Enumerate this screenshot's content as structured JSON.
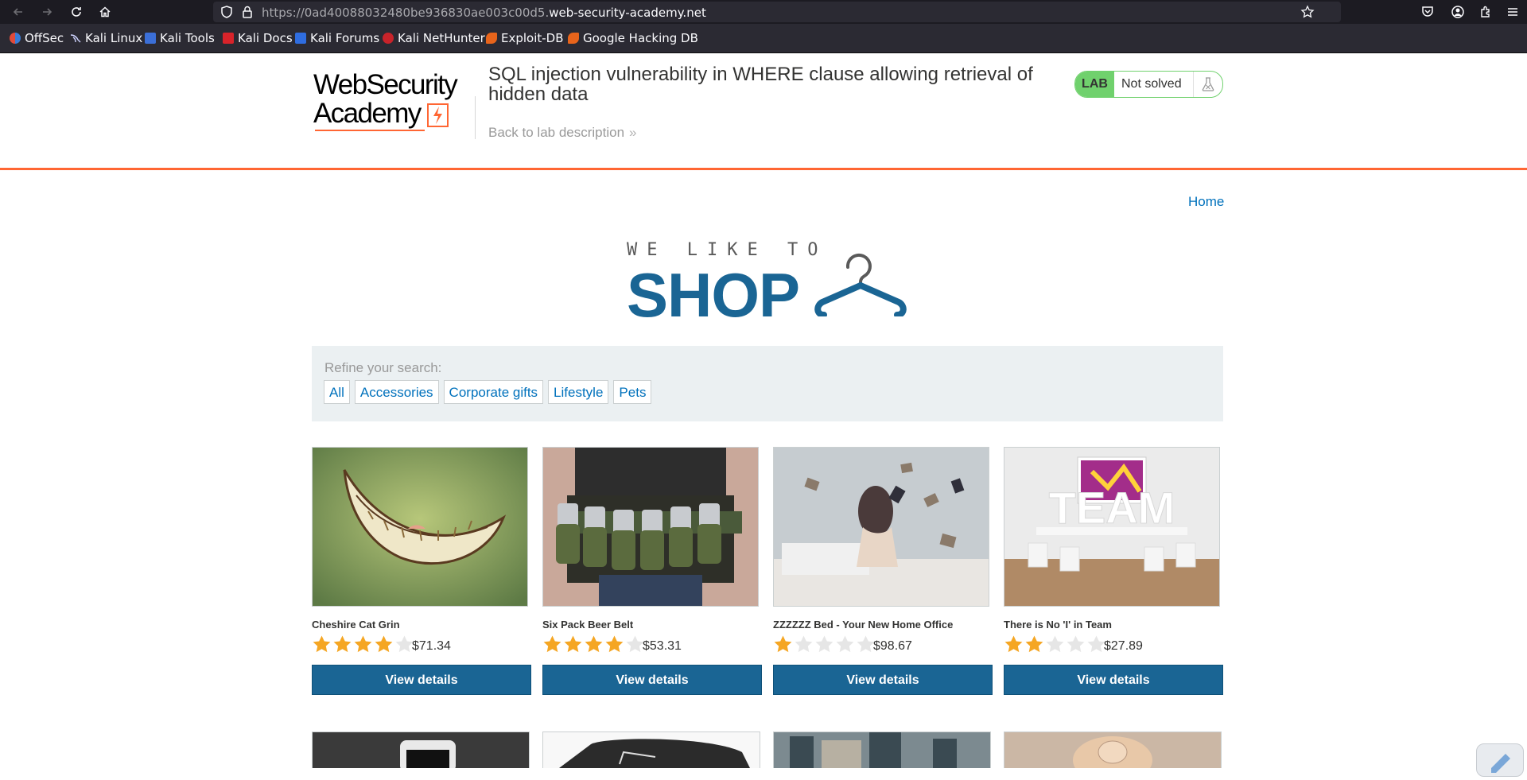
{
  "browser": {
    "url_prefix": "https://0ad40088032480be936830ae003c00d5.",
    "url_domain": "web-security-academy.net",
    "bookmarks": [
      {
        "label": "OffSec",
        "icon": "offsec-icon"
      },
      {
        "label": "Kali Linux",
        "icon": "kali-dragon-icon"
      },
      {
        "label": "Kali Tools",
        "icon": "kali-tools-icon"
      },
      {
        "label": "Kali Docs",
        "icon": "kali-docs-icon"
      },
      {
        "label": "Kali Forums",
        "icon": "kali-forums-icon"
      },
      {
        "label": "Kali NetHunter",
        "icon": "nethunter-icon"
      },
      {
        "label": "Exploit-DB",
        "icon": "exploit-db-icon"
      },
      {
        "label": "Google Hacking DB",
        "icon": "ghdb-icon"
      }
    ]
  },
  "lab": {
    "logo_line1": "WebSecurity",
    "logo_line2": "Academy",
    "title": "SQL injection vulnerability in WHERE clause allowing retrieval of hidden data",
    "back_link": "Back to lab description",
    "badge": "LAB",
    "status": "Not solved"
  },
  "nav": {
    "home": "Home"
  },
  "shop_logo": {
    "small": "WE LIKE TO",
    "big": "SHOP"
  },
  "filters": {
    "label": "Refine your search:",
    "items": [
      "All",
      "Accessories",
      "Corporate gifts",
      "Lifestyle",
      "Pets"
    ]
  },
  "products": [
    {
      "name": "Cheshire Cat Grin",
      "rating": 4,
      "price": "$71.34",
      "button": "View details"
    },
    {
      "name": "Six Pack Beer Belt",
      "rating": 4,
      "price": "$53.31",
      "button": "View details"
    },
    {
      "name": "ZZZZZZ Bed - Your New Home Office",
      "rating": 1,
      "price": "$98.67",
      "button": "View details"
    },
    {
      "name": "There is No 'I' in Team",
      "rating": 2,
      "price": "$27.89",
      "button": "View details",
      "image_text": "TEAM"
    }
  ],
  "colors": {
    "accent_orange": "#ff6633",
    "button_blue": "#1a6594",
    "link_blue": "#0071bc",
    "lab_green": "#70d16d",
    "star_gold": "#f5a623"
  }
}
